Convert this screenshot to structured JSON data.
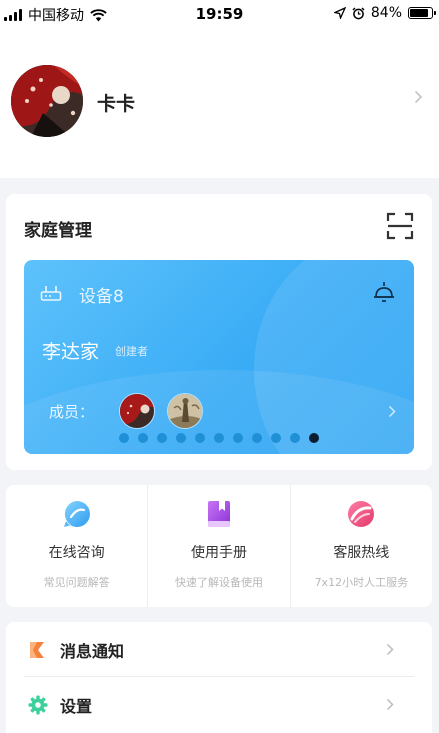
{
  "status_bar": {
    "carrier": "中国移动",
    "time": "19:59",
    "battery_percent": "84%",
    "battery_level": 0.84
  },
  "profile": {
    "username": "卡卡"
  },
  "family": {
    "title": "家庭管理",
    "card": {
      "device_name": "设备8",
      "home_name": "李达家",
      "creator_tag": "创建者",
      "members_label": "成员："
    },
    "pagination": {
      "total": 11,
      "active_index": 10
    }
  },
  "services": [
    {
      "name": "在线咨询",
      "desc": "常见问题解答",
      "icon": "chat-bubble-icon",
      "color": "#4fb3f5"
    },
    {
      "name": "使用手册",
      "desc": "快速了解设备使用",
      "icon": "book-icon",
      "color": "#a54be6"
    },
    {
      "name": "客服热线",
      "desc": "7x12小时人工服务",
      "icon": "hotline-icon",
      "color": "#ee4b7c"
    }
  ],
  "menu": [
    {
      "label": "消息通知",
      "icon": "notification-icon",
      "color": "#f5823a"
    },
    {
      "label": "设置",
      "icon": "gear-icon",
      "color": "#3cd19c"
    }
  ]
}
